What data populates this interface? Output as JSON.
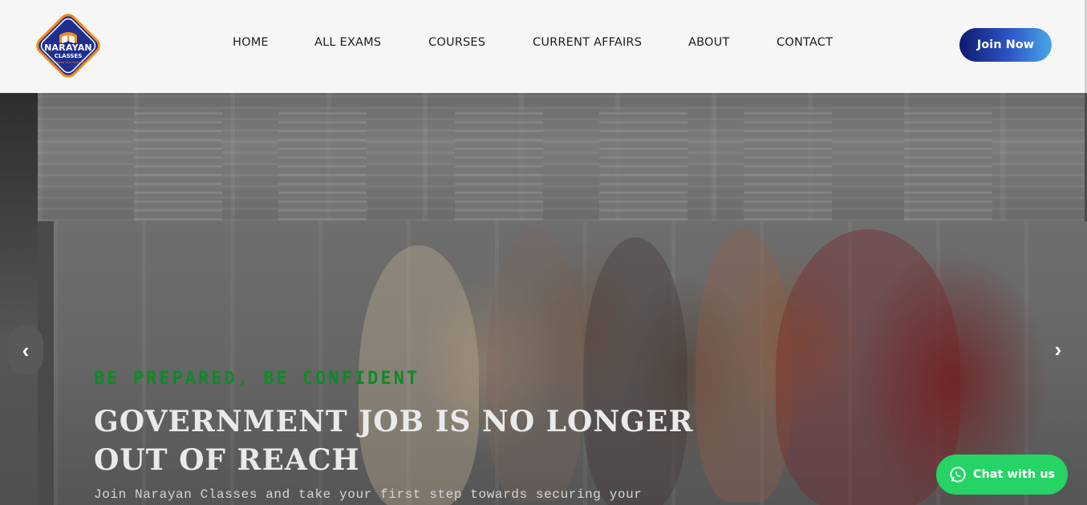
{
  "brand": {
    "logo_line1": "NARAYAN",
    "logo_line2": "CLASSES",
    "logo_tagline": "A DREAM THAT TEACHES"
  },
  "nav": {
    "items": [
      {
        "label": "HOME"
      },
      {
        "label": "ALL EXAMS"
      },
      {
        "label": "COURSES"
      },
      {
        "label": "CURRENT AFFAIRS"
      },
      {
        "label": "ABOUT"
      },
      {
        "label": "CONTACT"
      }
    ],
    "cta_label": "Join Now"
  },
  "hero": {
    "tagline": "BE PREPARED, BE CONFIDENT",
    "headline": "GOVERNMENT JOB IS NO LONGER OUT OF REACH",
    "subtext": "Join Narayan Classes and take your first step towards securing your",
    "prev_icon": "‹",
    "next_icon": "›"
  },
  "chat": {
    "label": "Chat with us",
    "icon": "whatsapp-icon"
  },
  "colors": {
    "header_bg": "#f6f6f6",
    "join_gradient_start": "#0e1a6e",
    "join_gradient_end": "#4aa6ea",
    "tagline": "#0f8a26",
    "chat_bg": "#25d366",
    "logo_blue": "#1f2f8f",
    "logo_orange": "#f58a1f"
  }
}
